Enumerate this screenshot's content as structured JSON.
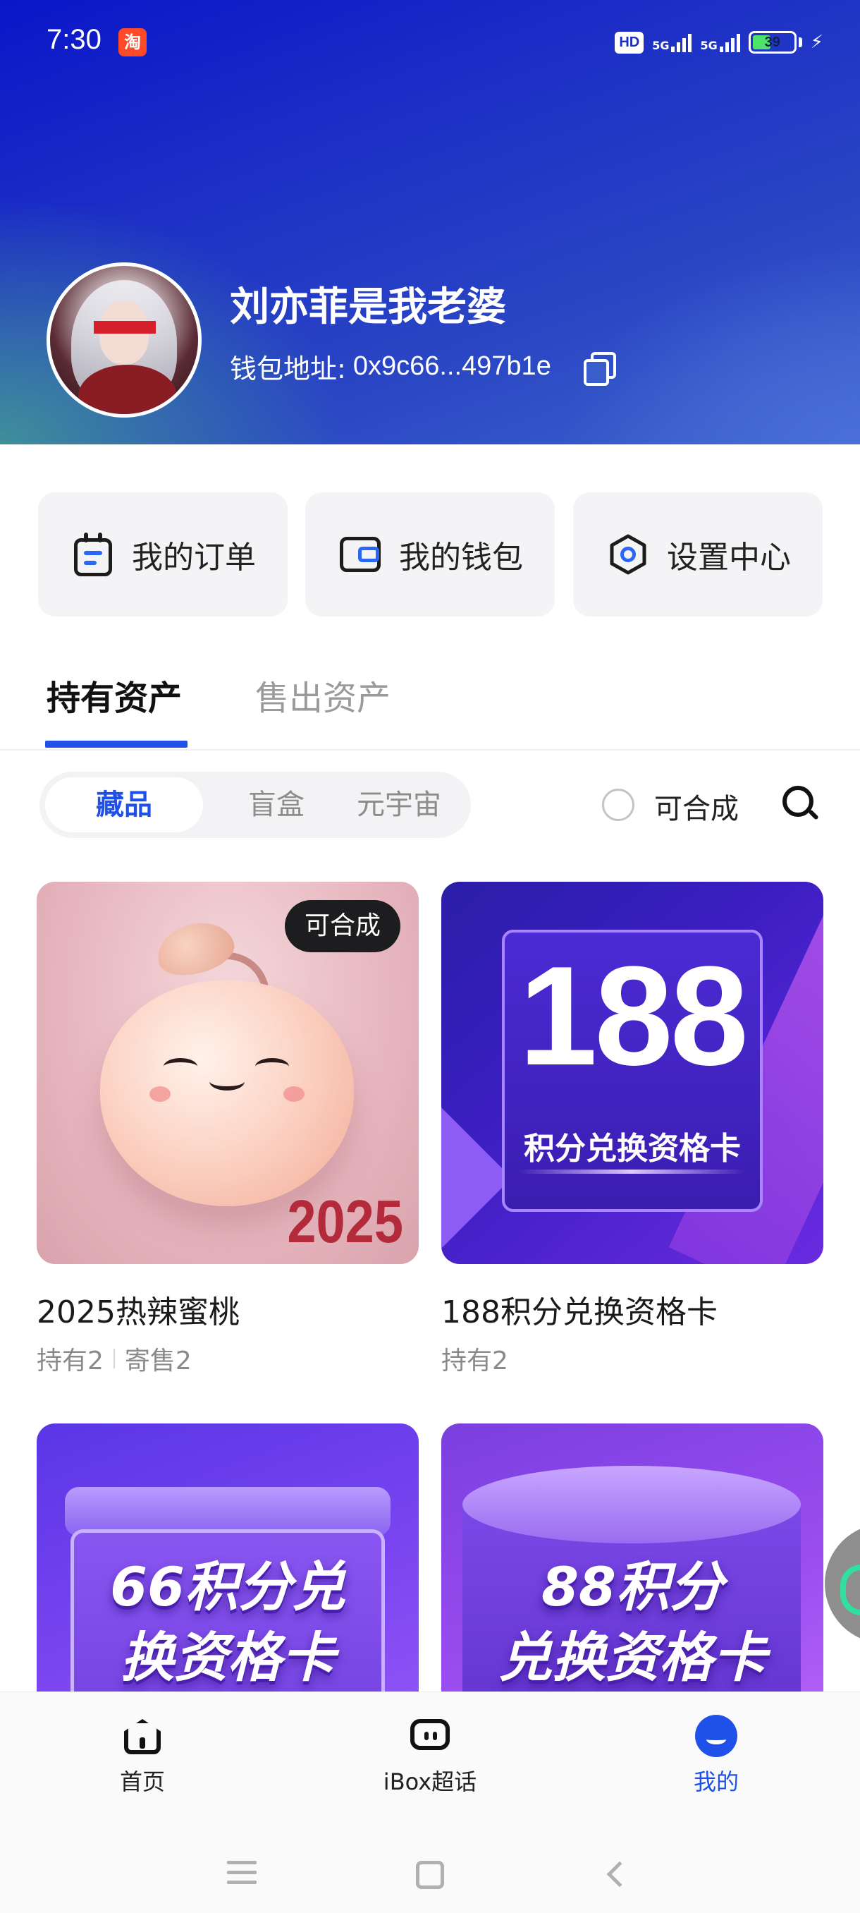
{
  "status_bar": {
    "time": "7:30",
    "app_icon_glyph": "淘",
    "hd": "HD",
    "net1": "5G",
    "net2": "5G",
    "battery": "39"
  },
  "profile": {
    "username": "刘亦菲是我老婆",
    "wallet_label": "钱包地址:",
    "wallet_address": "0x9c66...497b1e"
  },
  "shortcuts": [
    {
      "label": "我的订单",
      "icon": "order-icon"
    },
    {
      "label": "我的钱包",
      "icon": "wallet-icon"
    },
    {
      "label": "设置中心",
      "icon": "gear-icon"
    }
  ],
  "tabs": {
    "active": "持有资产",
    "inactive": "售出资产"
  },
  "filter": {
    "segments": [
      "藏品",
      "盲盒",
      "元宇宙"
    ],
    "selected": "藏品",
    "checkbox_label": "可合成"
  },
  "cards": [
    {
      "title": "2025热辣蜜桃",
      "tag": "可合成",
      "image_text": "2025",
      "holding": "持有2",
      "consign": "寄售2"
    },
    {
      "title": "188积分兑换资格卡",
      "image_num": "188",
      "image_text": "积分兑换资格卡",
      "holding": "持有2"
    },
    {
      "image_line1": "66积分兑",
      "image_line2": "换资格卡"
    },
    {
      "image_line1": "88积分",
      "image_line2": "兑换资格卡"
    }
  ],
  "bottom_nav": [
    {
      "label": "首页",
      "icon": "home-icon"
    },
    {
      "label": "iBox超话",
      "icon": "chat-icon"
    },
    {
      "label": "我的",
      "icon": "profile-icon",
      "active": true
    }
  ],
  "colors": {
    "accent": "#1f50e8",
    "header_start": "#0a16c8",
    "header_end": "#3c63cc"
  }
}
